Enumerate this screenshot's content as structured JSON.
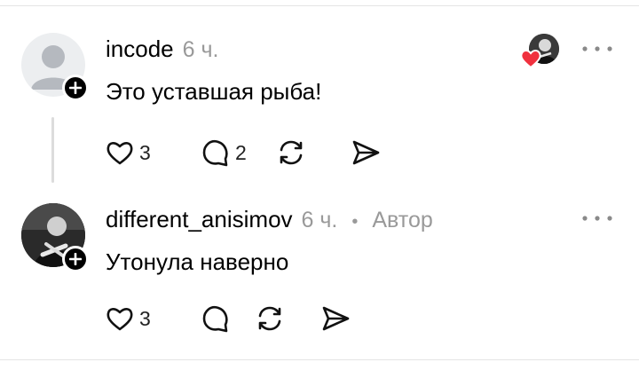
{
  "comments": [
    {
      "username": "incode",
      "time": "6 ч.",
      "text": "Это уставшая рыба!",
      "likes": "3",
      "replies": "2",
      "has_author_badge": false,
      "liked_by_author": true
    },
    {
      "username": "different_anisimov",
      "time": "6 ч.",
      "dot": "•",
      "author_label": "Автор",
      "text": "Утонула наверно",
      "likes": "3",
      "replies": "",
      "has_author_badge": true,
      "liked_by_author": false
    }
  ],
  "icons": {
    "like": "heart-outline-icon",
    "reply": "speech-bubble-icon",
    "repost": "repost-arrows-icon",
    "share": "send-icon",
    "more": "more-dots-icon",
    "follow": "plus-icon",
    "liked_heart": "heart-filled-icon"
  },
  "colors": {
    "liked_heart": "#f0313e",
    "muted_text": "#999999",
    "divider": "#e4e4e4"
  }
}
